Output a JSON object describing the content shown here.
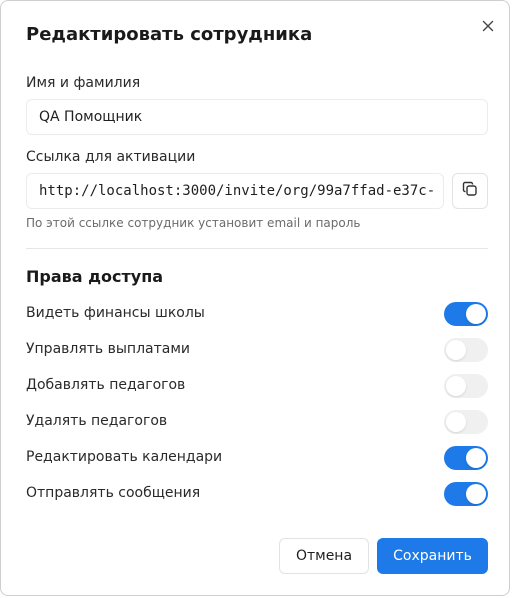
{
  "dialog": {
    "title": "Редактировать сотрудника",
    "close_icon": "close-icon"
  },
  "name_field": {
    "label": "Имя и фамилия",
    "value": "QA Помощник"
  },
  "activation_link": {
    "label": "Ссылка для активации",
    "value": "http://localhost:3000/invite/org/99a7ffad-e37c-",
    "copy_icon": "copy-icon",
    "hint": "По этой ссылке сотрудник установит email и пароль"
  },
  "permissions": {
    "title": "Права доступа",
    "items": [
      {
        "label": "Видеть финансы школы",
        "enabled": true
      },
      {
        "label": "Управлять выплатами",
        "enabled": false
      },
      {
        "label": "Добавлять педагогов",
        "enabled": false
      },
      {
        "label": "Удалять педагогов",
        "enabled": false
      },
      {
        "label": "Редактировать календари",
        "enabled": true
      },
      {
        "label": "Отправлять сообщения",
        "enabled": true
      }
    ]
  },
  "footer": {
    "cancel_label": "Отмена",
    "save_label": "Сохранить"
  },
  "colors": {
    "accent": "#1d7ae8",
    "toggle_off": "#f0f0f0"
  }
}
